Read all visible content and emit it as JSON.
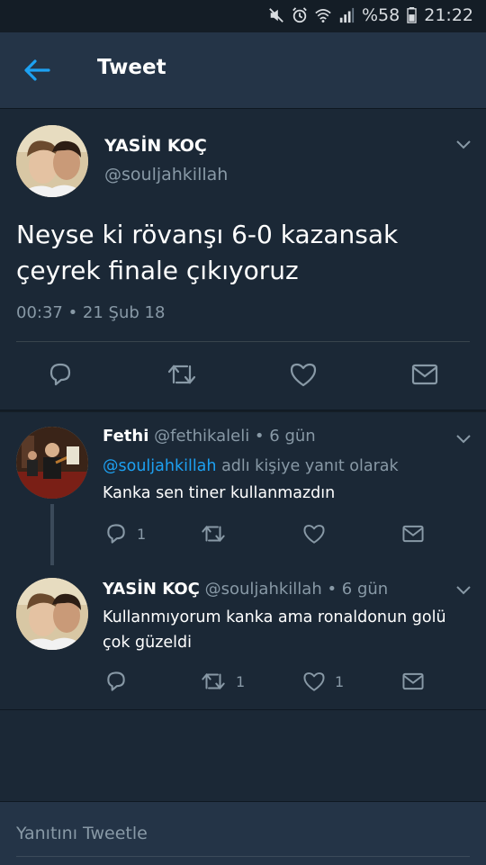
{
  "status_bar": {
    "battery": "%58",
    "time": "21:22"
  },
  "header": {
    "title": "Tweet"
  },
  "main_tweet": {
    "name": "YASİN KOÇ",
    "handle": "@souljahkillah",
    "text_line1": "Neyse ki rövanşı 6-0 kazansak",
    "text_line2": "çeyrek finale çıkıyoruz",
    "timestamp": "00:37 • 21 Şub 18"
  },
  "replies": [
    {
      "name": "Fethi",
      "handle": "@fethikaleli",
      "age": " • 6 gün",
      "reply_to_mention": "@souljahkillah",
      "reply_to_suffix": " adlı kişiye yanıt olarak",
      "text_line1": "Kanka sen tiner kullanmazdın",
      "text_line2": "",
      "reply_count": "1",
      "retweet_count": "",
      "like_count": ""
    },
    {
      "name": "YASİN KOÇ",
      "handle": "@souljahkillah",
      "age": " • 6 gün",
      "text_line1": "Kullanmıyorum kanka ama ronaldonun golü",
      "text_line2": "çok güzeldi",
      "reply_count": "",
      "retweet_count": "1",
      "like_count": "1"
    }
  ],
  "compose": {
    "placeholder": "Yanıtını Tweetle"
  },
  "colors": {
    "background": "#141d26",
    "card": "#1b2836",
    "bar": "#243447",
    "accent": "#1da1f2",
    "muted": "#8899a6"
  },
  "icons": [
    "mute-icon",
    "alarm-icon",
    "wifi-icon",
    "signal-icon",
    "battery-icon",
    "back-arrow-icon",
    "chevron-down-icon",
    "reply-icon",
    "retweet-icon",
    "like-icon",
    "mail-icon"
  ]
}
